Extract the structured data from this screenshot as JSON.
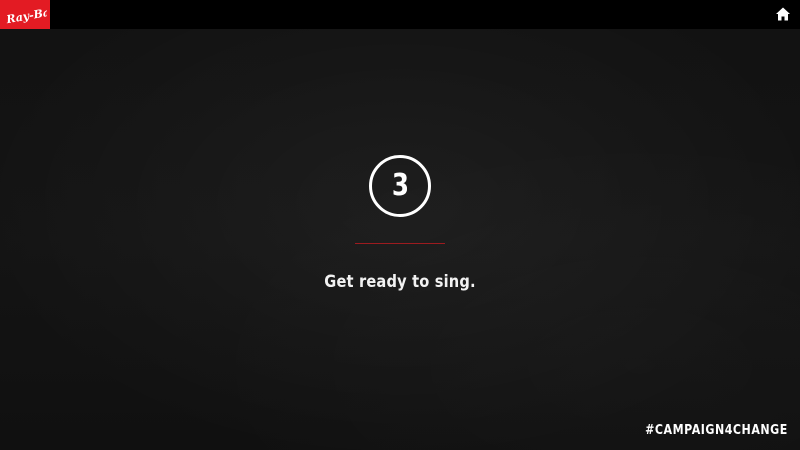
{
  "brand": {
    "logo_text": "Ray-Ban",
    "accent_color": "#e31b23"
  },
  "header": {
    "home_icon": "home-icon"
  },
  "countdown": {
    "number": "3"
  },
  "main": {
    "message": "Get ready to sing.",
    "divider_color": "#9c1b1f"
  },
  "footer": {
    "hashtag": "#CAMPAIGN4CHANGE"
  }
}
